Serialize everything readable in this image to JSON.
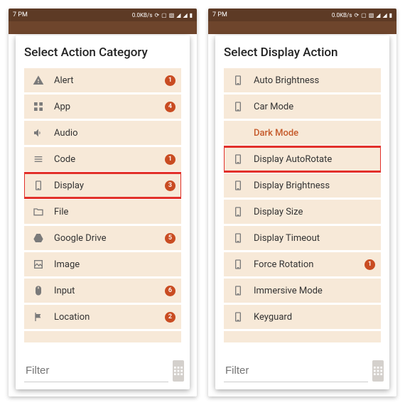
{
  "statusbar": {
    "time": "7 PM",
    "speed": "0.0KB/s"
  },
  "left": {
    "title": "Select Action Category",
    "rows": [
      {
        "icon": "alert",
        "label": "Alert",
        "badge": "1"
      },
      {
        "icon": "app",
        "label": "App",
        "badge": "4"
      },
      {
        "icon": "audio",
        "label": "Audio"
      },
      {
        "icon": "code",
        "label": "Code",
        "badge": "1"
      },
      {
        "icon": "phone",
        "label": "Display",
        "badge": "3",
        "hl": true
      },
      {
        "icon": "folder",
        "label": "File"
      },
      {
        "icon": "drive",
        "label": "Google Drive",
        "badge": "5"
      },
      {
        "icon": "image",
        "label": "Image"
      },
      {
        "icon": "mouse",
        "label": "Input",
        "badge": "6"
      },
      {
        "icon": "flag",
        "label": "Location",
        "badge": "2"
      }
    ],
    "filter_placeholder": "Filter"
  },
  "right": {
    "title": "Select Display Action",
    "rows": [
      {
        "icon": "phone",
        "label": "Auto Brightness"
      },
      {
        "icon": "phone",
        "label": "Car Mode"
      },
      {
        "textonly": true,
        "label": "Dark Mode"
      },
      {
        "icon": "phone",
        "label": "Display AutoRotate",
        "hl": true
      },
      {
        "icon": "phone",
        "label": "Display Brightness"
      },
      {
        "icon": "phone",
        "label": "Display Size"
      },
      {
        "icon": "phone",
        "label": "Display Timeout"
      },
      {
        "icon": "phone",
        "label": "Force Rotation",
        "badge": "1"
      },
      {
        "icon": "phone",
        "label": "Immersive Mode"
      },
      {
        "icon": "phone",
        "label": "Keyguard"
      }
    ],
    "filter_placeholder": "Filter"
  },
  "colors": {
    "accent": "#c94c22",
    "rowbg": "#f7e9d8",
    "topbar": "#6e452c",
    "highlight": "#e2302a"
  }
}
